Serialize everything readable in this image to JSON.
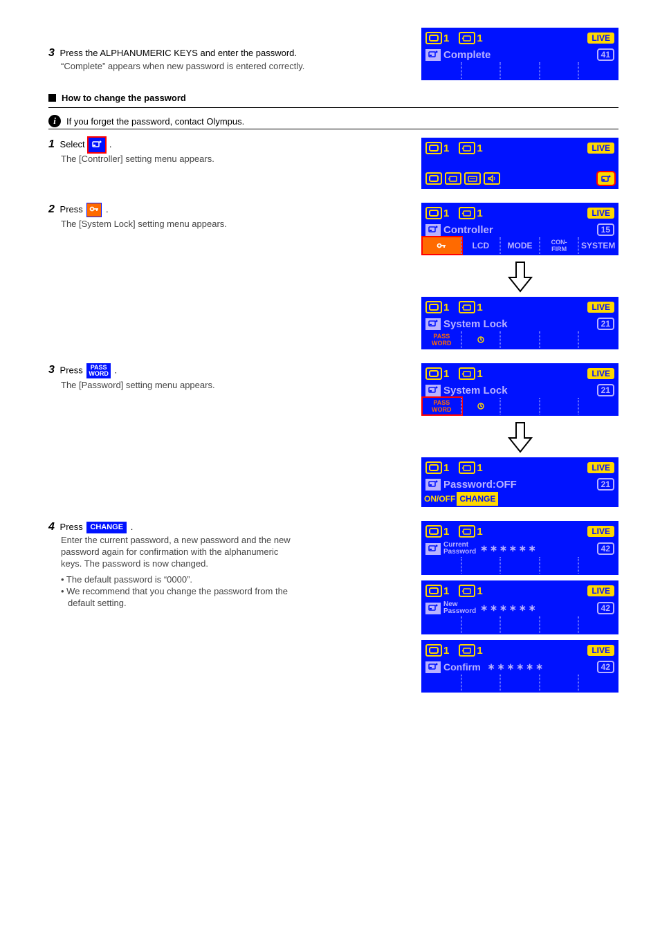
{
  "intro": {
    "stepNum": "3",
    "stepText": "Press the ALPHANUMERIC KEYS and enter the password.",
    "completeMsg": "“Complete” appears when new password is entered correctly."
  },
  "section": {
    "title": "How to change the password",
    "infoNote": "If you forget the password, contact Olympus."
  },
  "p1": {
    "num": "1",
    "text": "Select",
    "text2": "The [Controller] setting menu appears.",
    "iconAria": "Controller settings tab"
  },
  "p2": {
    "num": "2",
    "text1": "Press",
    "text2": "The [System Lock] setting menu appears.",
    "iconAria": "Key (System Lock) soft key"
  },
  "p3": {
    "num": "3",
    "text1": "Press",
    "text2": "The [Password] setting menu appears.",
    "iconAria": "PASSWORD soft key"
  },
  "p4": {
    "num": "4",
    "text1": "Press",
    "text2a": "Enter the current password, a new password and the new",
    "text2b": "password again for confirmation with the alphanumeric",
    "text2c": "keys. The password is now changed.",
    "iconLabel": "CHANGE",
    "note1": "• The default password is “0000”.",
    "note2": "• We recommend that you change the password from the",
    "note2b": "default setting."
  },
  "lcdComplete": {
    "n1": "1",
    "n2": "1",
    "live": "LIVE",
    "title": "Complete",
    "badge": "41"
  },
  "lcdCtrlTabs": {
    "n1": "1",
    "n2": "1",
    "live": "LIVE",
    "badge": ""
  },
  "lcdCtrl": {
    "n1": "1",
    "n2": "1",
    "live": "LIVE",
    "title": "Controller",
    "badge": "15",
    "soft": {
      "lcd": "LCD",
      "mode": "MODE",
      "confirm1": "CON-",
      "confirm2": "FIRM",
      "system": "SYSTEM"
    }
  },
  "lcdSysLock": {
    "n1": "1",
    "n2": "1",
    "live": "LIVE",
    "title": "System Lock",
    "badge": "21",
    "passLabel1": "PASS",
    "passLabel2": "WORD"
  },
  "lcdPassOff": {
    "n1": "1",
    "n2": "1",
    "live": "LIVE",
    "title": "Password:OFF",
    "badge": "21",
    "onoff": "ON/OFF",
    "change": "CHANGE"
  },
  "lcdCur": {
    "n1": "1",
    "n2": "1",
    "live": "LIVE",
    "l1": "Current",
    "l2": "Password",
    "stars": "∗∗∗∗∗∗",
    "badge": "42"
  },
  "lcdNew": {
    "n1": "1",
    "n2": "1",
    "live": "LIVE",
    "l1": "New",
    "l2": "Password",
    "stars": "∗∗∗∗∗∗",
    "badge": "42"
  },
  "lcdConf": {
    "n1": "1",
    "n2": "1",
    "live": "LIVE",
    "title": "Confirm",
    "stars": "∗∗∗∗∗∗",
    "badge": "42"
  }
}
